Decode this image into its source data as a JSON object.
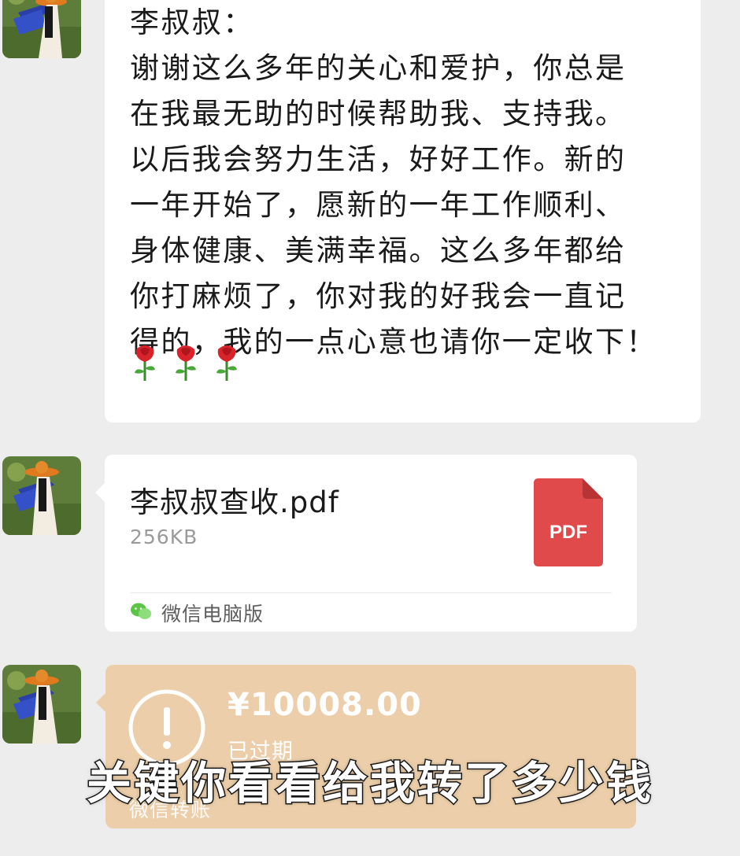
{
  "messages": [
    {
      "type": "text",
      "lines": [
        "李叔叔：",
        "谢谢这么多年的关心和爱护，你总是",
        "在我最无助的时候帮助我、支持我。",
        "以后我会努力生活，好好工作。新的",
        "一年开始了，愿新的一年工作顺利、",
        "身体健康、美满幸福。这么多年都给",
        "你打麻烦了，你对我的好我会一直记",
        "得的，我的一点心意也请你一定收下！"
      ],
      "emoji": [
        "rose-emoji",
        "rose-emoji",
        "rose-emoji"
      ]
    },
    {
      "type": "file",
      "file_name": "李叔叔查收.pdf",
      "file_size": "256KB",
      "file_type_label": "PDF",
      "source_label": "微信电脑版"
    },
    {
      "type": "transfer",
      "amount": "¥10008.00",
      "status": "已过期",
      "label": "微信转账"
    }
  ],
  "subtitle": "关键你看看给我转了多少钱",
  "colors": {
    "background": "#ededed",
    "bubble": "#ffffff",
    "transfer_expired": "#eccfaa",
    "pdf_red": "#e04a4a"
  }
}
